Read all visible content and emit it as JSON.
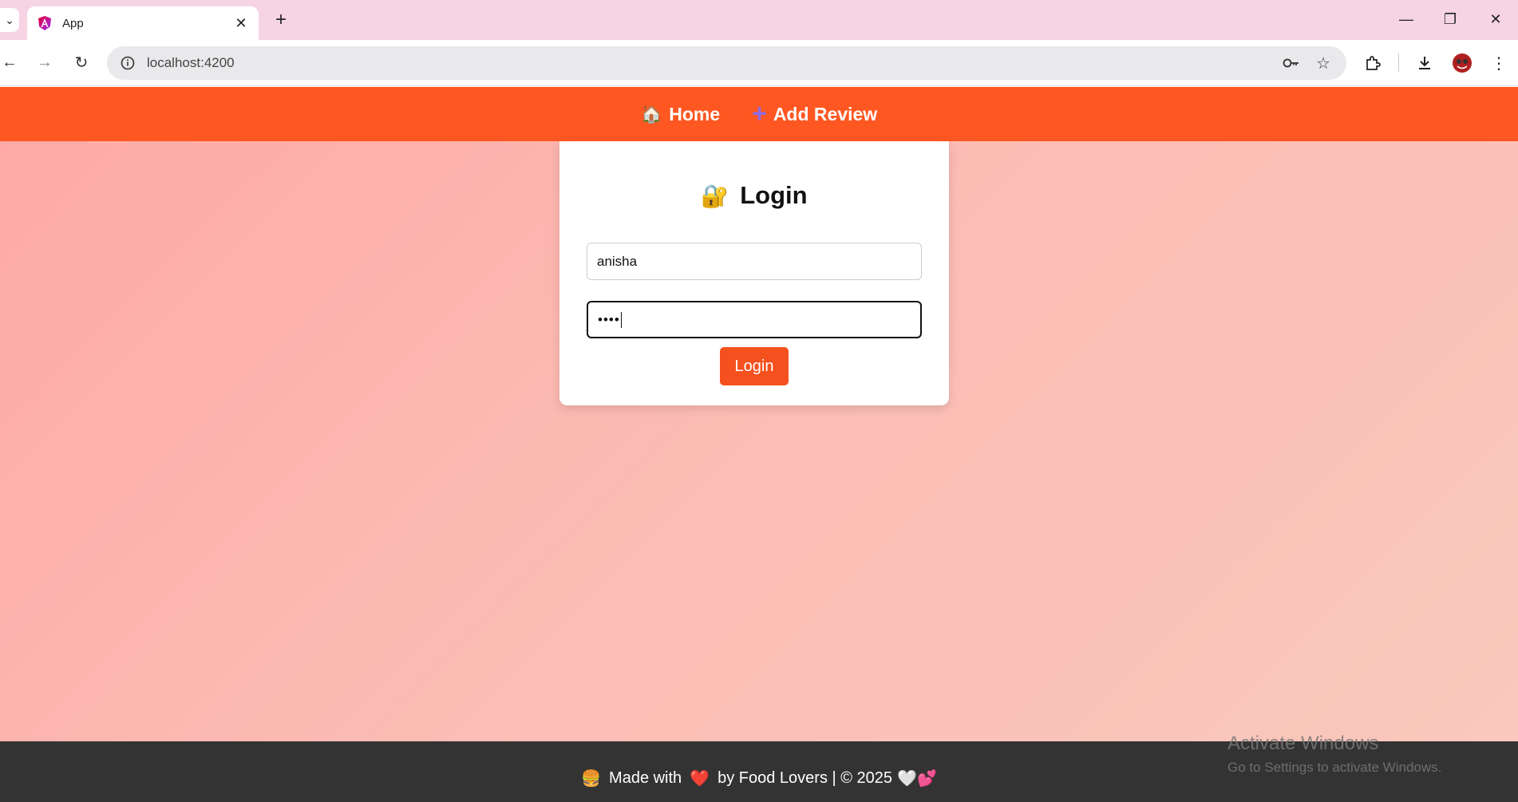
{
  "browser": {
    "tab_title": "App",
    "url": "localhost:4200"
  },
  "nav": {
    "home_emoji": "🏠",
    "home_label": "Home",
    "add_review_label": "Add Review"
  },
  "login": {
    "lock_emoji": "🔐",
    "title": "Login",
    "username_value": "anisha",
    "password_value": "••••",
    "button_label": "Login"
  },
  "footer": {
    "burger_emoji": "🍔",
    "text_made_with": "Made with",
    "heart_emoji": "❤️",
    "text_by": "by Food Lovers | © 2025",
    "white_heart_emoji": "🤍",
    "pink_hearts_emoji": "💕"
  },
  "watermark": {
    "title": "Activate Windows",
    "subtitle": "Go to Settings to activate Windows."
  }
}
